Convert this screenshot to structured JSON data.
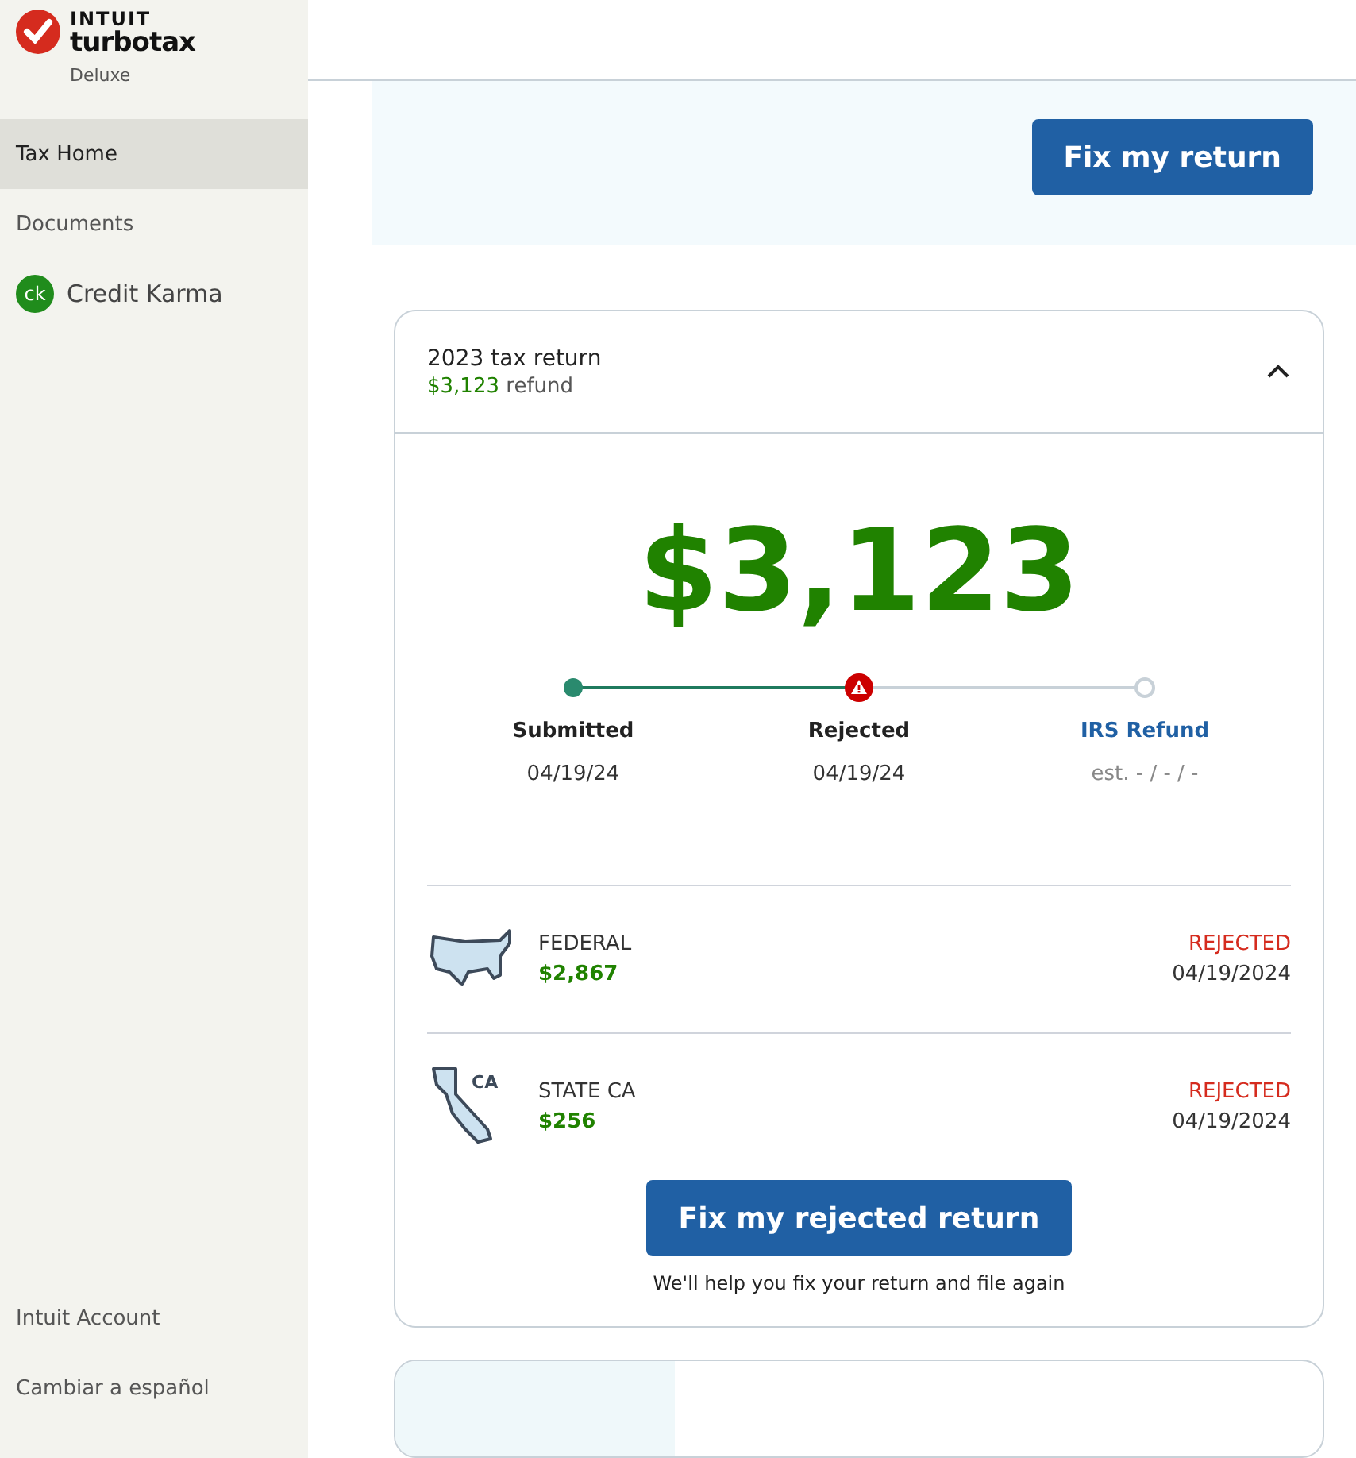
{
  "brand": {
    "company": "INTUIT",
    "product": "turbotax",
    "edition": "Deluxe"
  },
  "sidebar": {
    "items": [
      {
        "label": "Tax Home",
        "selected": true
      },
      {
        "label": "Documents",
        "selected": false
      },
      {
        "label": "Credit Karma",
        "selected": false,
        "kind": "credit_karma",
        "badge": "ck"
      }
    ],
    "footer_items": [
      {
        "label": "Intuit Account"
      },
      {
        "label": "Cambiar a español"
      }
    ]
  },
  "banner": {
    "button": "Fix my return"
  },
  "return_card": {
    "title": "2023 tax return",
    "refund_amount": "$3,123",
    "refund_label": "refund",
    "expanded": true,
    "big_amount": "$3,123",
    "steps": [
      {
        "label": "Submitted",
        "date": "04/19/24",
        "kind": "done"
      },
      {
        "label": "Rejected",
        "date": "04/19/24",
        "kind": "error"
      },
      {
        "label": "IRS Refund",
        "date": "est. - / - / -",
        "kind": "pending"
      }
    ],
    "filings": [
      {
        "kind": "federal",
        "name": "FEDERAL",
        "amount": "$2,867",
        "status": "REJECTED",
        "date": "04/19/2024"
      },
      {
        "kind": "state",
        "name": "STATE CA",
        "state_code": "CA",
        "amount": "$256",
        "status": "REJECTED",
        "date": "04/19/2024"
      }
    ],
    "button": "Fix my rejected return",
    "note": "We'll help you fix your return and file again"
  }
}
